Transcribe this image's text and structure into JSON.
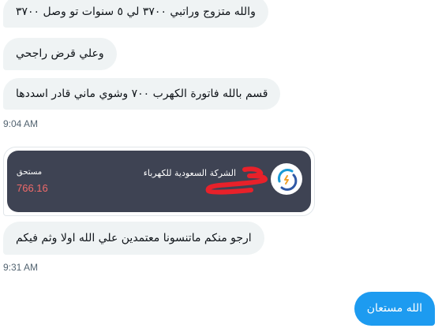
{
  "conversation": {
    "messages_block_1": [
      {
        "text": "والله متزوج وراتبي ٣٧٠٠ لي ٥ سنوات تو وصل ٣٧٠٠"
      },
      {
        "text": "وعلي قرض راجحي"
      },
      {
        "text": "قسم بالله فاتورة الكهرب ٧٠٠ وشوي ماني قادر اسددها"
      }
    ],
    "timestamp_1": "9:04 AM",
    "bill_card": {
      "due_label": "مستحق",
      "amount": "766.16",
      "company": "الشركة السعودية للكهرباء",
      "logo_icon": "sec-logo-icon",
      "amount_color": "#f06a6a",
      "card_bg": "#3e4353"
    },
    "message_after_card": {
      "text": "ارجو منكم ماتنسونا معتمدين علي الله اولا وثم فيكم"
    },
    "timestamp_2": "9:31 AM",
    "outgoing_message": {
      "text": "الله مستعان"
    }
  },
  "colors": {
    "incoming_bubble": "#eff3f4",
    "outgoing_bubble": "#1d9bf0",
    "timestamp": "#536471",
    "redaction": "#e8212a"
  }
}
